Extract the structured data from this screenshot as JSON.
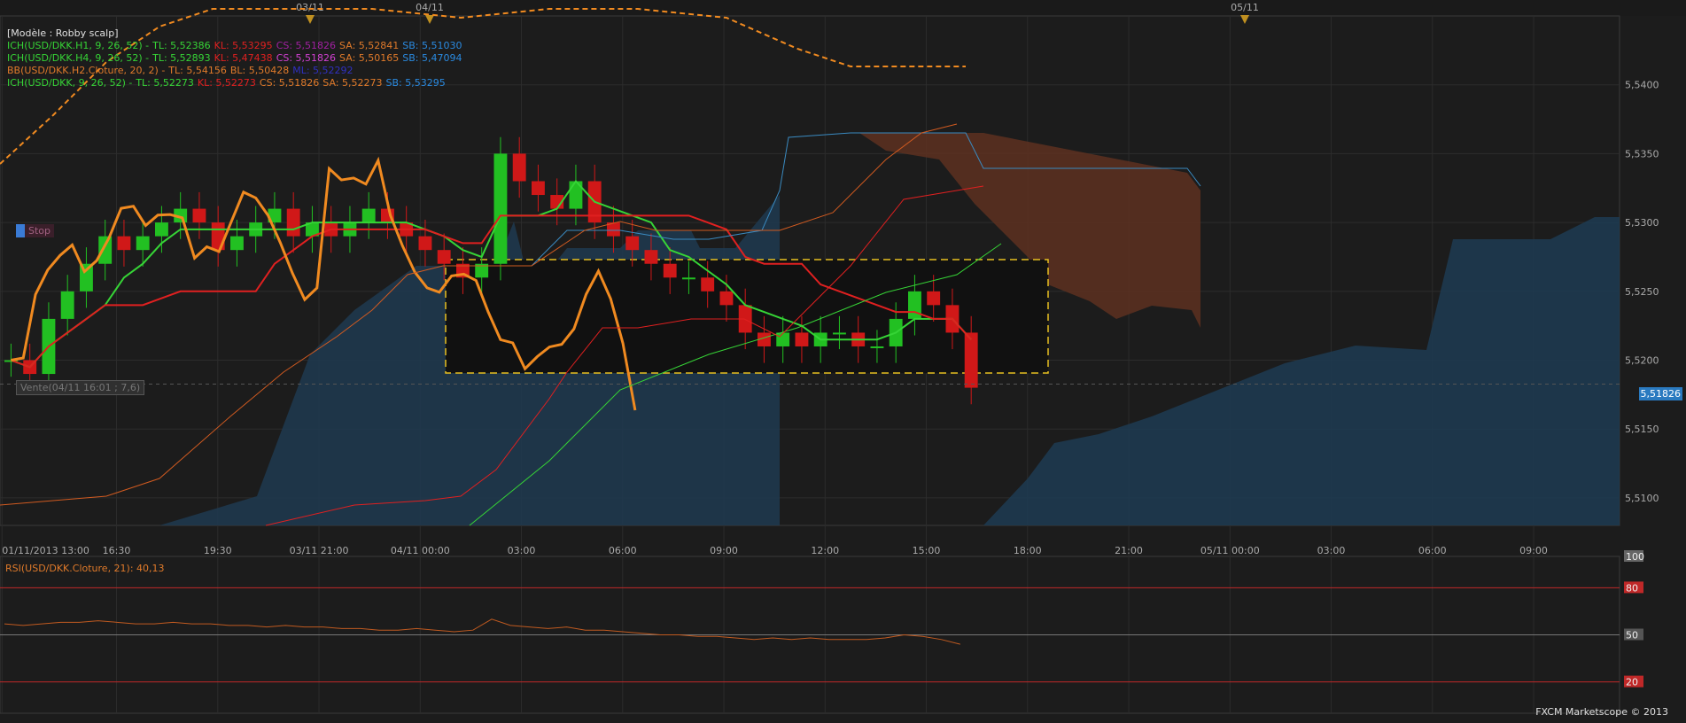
{
  "template_name": "[Modèle : Robby scalp]",
  "legend": [
    {
      "parts": [
        {
          "text": "ICH(USD/DKK.H1, 9, 26, 52) -",
          "color": "#36d436"
        },
        {
          "text": "TL: 5,52386",
          "color": "#36d436"
        },
        {
          "text": "KL: 5,53295",
          "color": "#e02020"
        },
        {
          "text": "CS: 5,51826",
          "color": "#a020a0"
        },
        {
          "text": "SA: 5,52841",
          "color": "#e07a2a"
        },
        {
          "text": "SB: 5,51030",
          "color": "#2a8ae0"
        }
      ]
    },
    {
      "parts": [
        {
          "text": "ICH(USD/DKK.H4, 9, 26, 52) -",
          "color": "#36d436"
        },
        {
          "text": "TL: 5,52893",
          "color": "#36d436"
        },
        {
          "text": "KL: 5,47438",
          "color": "#e02020"
        },
        {
          "text": "CS: 5,51826",
          "color": "#d040d0"
        },
        {
          "text": "SA: 5,50165",
          "color": "#e07a2a"
        },
        {
          "text": "SB: 5,47094",
          "color": "#2a8ae0"
        }
      ]
    },
    {
      "parts": [
        {
          "text": "BB(USD/DKK.H2.Cloture, 20, 2) -",
          "color": "#e07a2a"
        },
        {
          "text": "TL: 5,54156",
          "color": "#e07a2a"
        },
        {
          "text": "BL: 5,50428",
          "color": "#e07a2a"
        },
        {
          "text": "ML: 5,52292",
          "color": "#3030c0"
        }
      ]
    },
    {
      "parts": [
        {
          "text": "ICH(USD/DKK, 9, 26, 52) -",
          "color": "#36d436"
        },
        {
          "text": "TL: 5,52273",
          "color": "#36d436"
        },
        {
          "text": "KL: 5,52273",
          "color": "#e02020"
        },
        {
          "text": "CS: 5,51826",
          "color": "#e07a2a"
        },
        {
          "text": "SA: 5,52273",
          "color": "#e07a2a"
        },
        {
          "text": "SB: 5,53295",
          "color": "#2a8ae0"
        }
      ]
    }
  ],
  "stop_label": "Stop",
  "vente_label": "Vente(04/11 16:01 ; 7,6)",
  "last_price": "5,51826",
  "rsi_label": "RSI(USD/DKK.Cloture, 21): 40,13",
  "footer": "FXCM Marketscope © 2013",
  "top_markers": [
    "03/11",
    "04/11",
    "05/11"
  ],
  "colors": {
    "bg": "#1c1c1c",
    "grid": "#2c2c2c",
    "up": "#22c022",
    "down": "#d01818",
    "tenkan": "#36d436",
    "kijun": "#e02020",
    "cloudBlue": "#1e3a50",
    "cloudOrange": "#5a3020",
    "bb": "#f08a20",
    "rsi": "#c05a20",
    "zone": "#e8c020"
  },
  "chart_data": {
    "type": "line",
    "title": "USD/DKK",
    "ylim": [
      5.508,
      5.545
    ],
    "price_ticks": [
      "5,5400",
      "5,5350",
      "5,5300",
      "5,5250",
      "5,5200",
      "5,5150",
      "5,5100"
    ],
    "time_ticks": [
      "01/11/2013 13:00",
      "16:30",
      "19:30",
      "03/11 21:00",
      "04/11 00:00",
      "03:00",
      "06:00",
      "09:00",
      "12:00",
      "15:00",
      "18:00",
      "21:00",
      "05/11 00:00",
      "03:00",
      "06:00",
      "09:00"
    ],
    "rsi_ticks": [
      "100",
      "80",
      "50",
      "20"
    ],
    "rsi_levels": [
      80,
      50,
      20
    ],
    "rsi_ylim": [
      0,
      100
    ],
    "close_series": [
      5.52,
      5.519,
      5.523,
      5.525,
      5.527,
      5.529,
      5.528,
      5.529,
      5.53,
      5.531,
      5.53,
      5.528,
      5.529,
      5.53,
      5.531,
      5.529,
      5.53,
      5.529,
      5.53,
      5.531,
      5.53,
      5.529,
      5.528,
      5.527,
      5.526,
      5.527,
      5.535,
      5.533,
      5.532,
      5.531,
      5.533,
      5.53,
      5.529,
      5.528,
      5.527,
      5.526,
      5.526,
      5.525,
      5.524,
      5.522,
      5.521,
      5.522,
      5.521,
      5.522,
      5.522,
      5.521,
      5.521,
      5.523,
      5.525,
      5.524,
      5.522,
      5.518
    ],
    "rsi_series": [
      57,
      56,
      57,
      58,
      58,
      59,
      58,
      57,
      57,
      58,
      57,
      57,
      56,
      56,
      55,
      56,
      55,
      55,
      54,
      54,
      53,
      53,
      54,
      53,
      52,
      53,
      60,
      56,
      55,
      54,
      55,
      53,
      53,
      52,
      51,
      50,
      50,
      49,
      49,
      48,
      47,
      48,
      47,
      48,
      47,
      47,
      47,
      48,
      50,
      49,
      47,
      44
    ]
  }
}
